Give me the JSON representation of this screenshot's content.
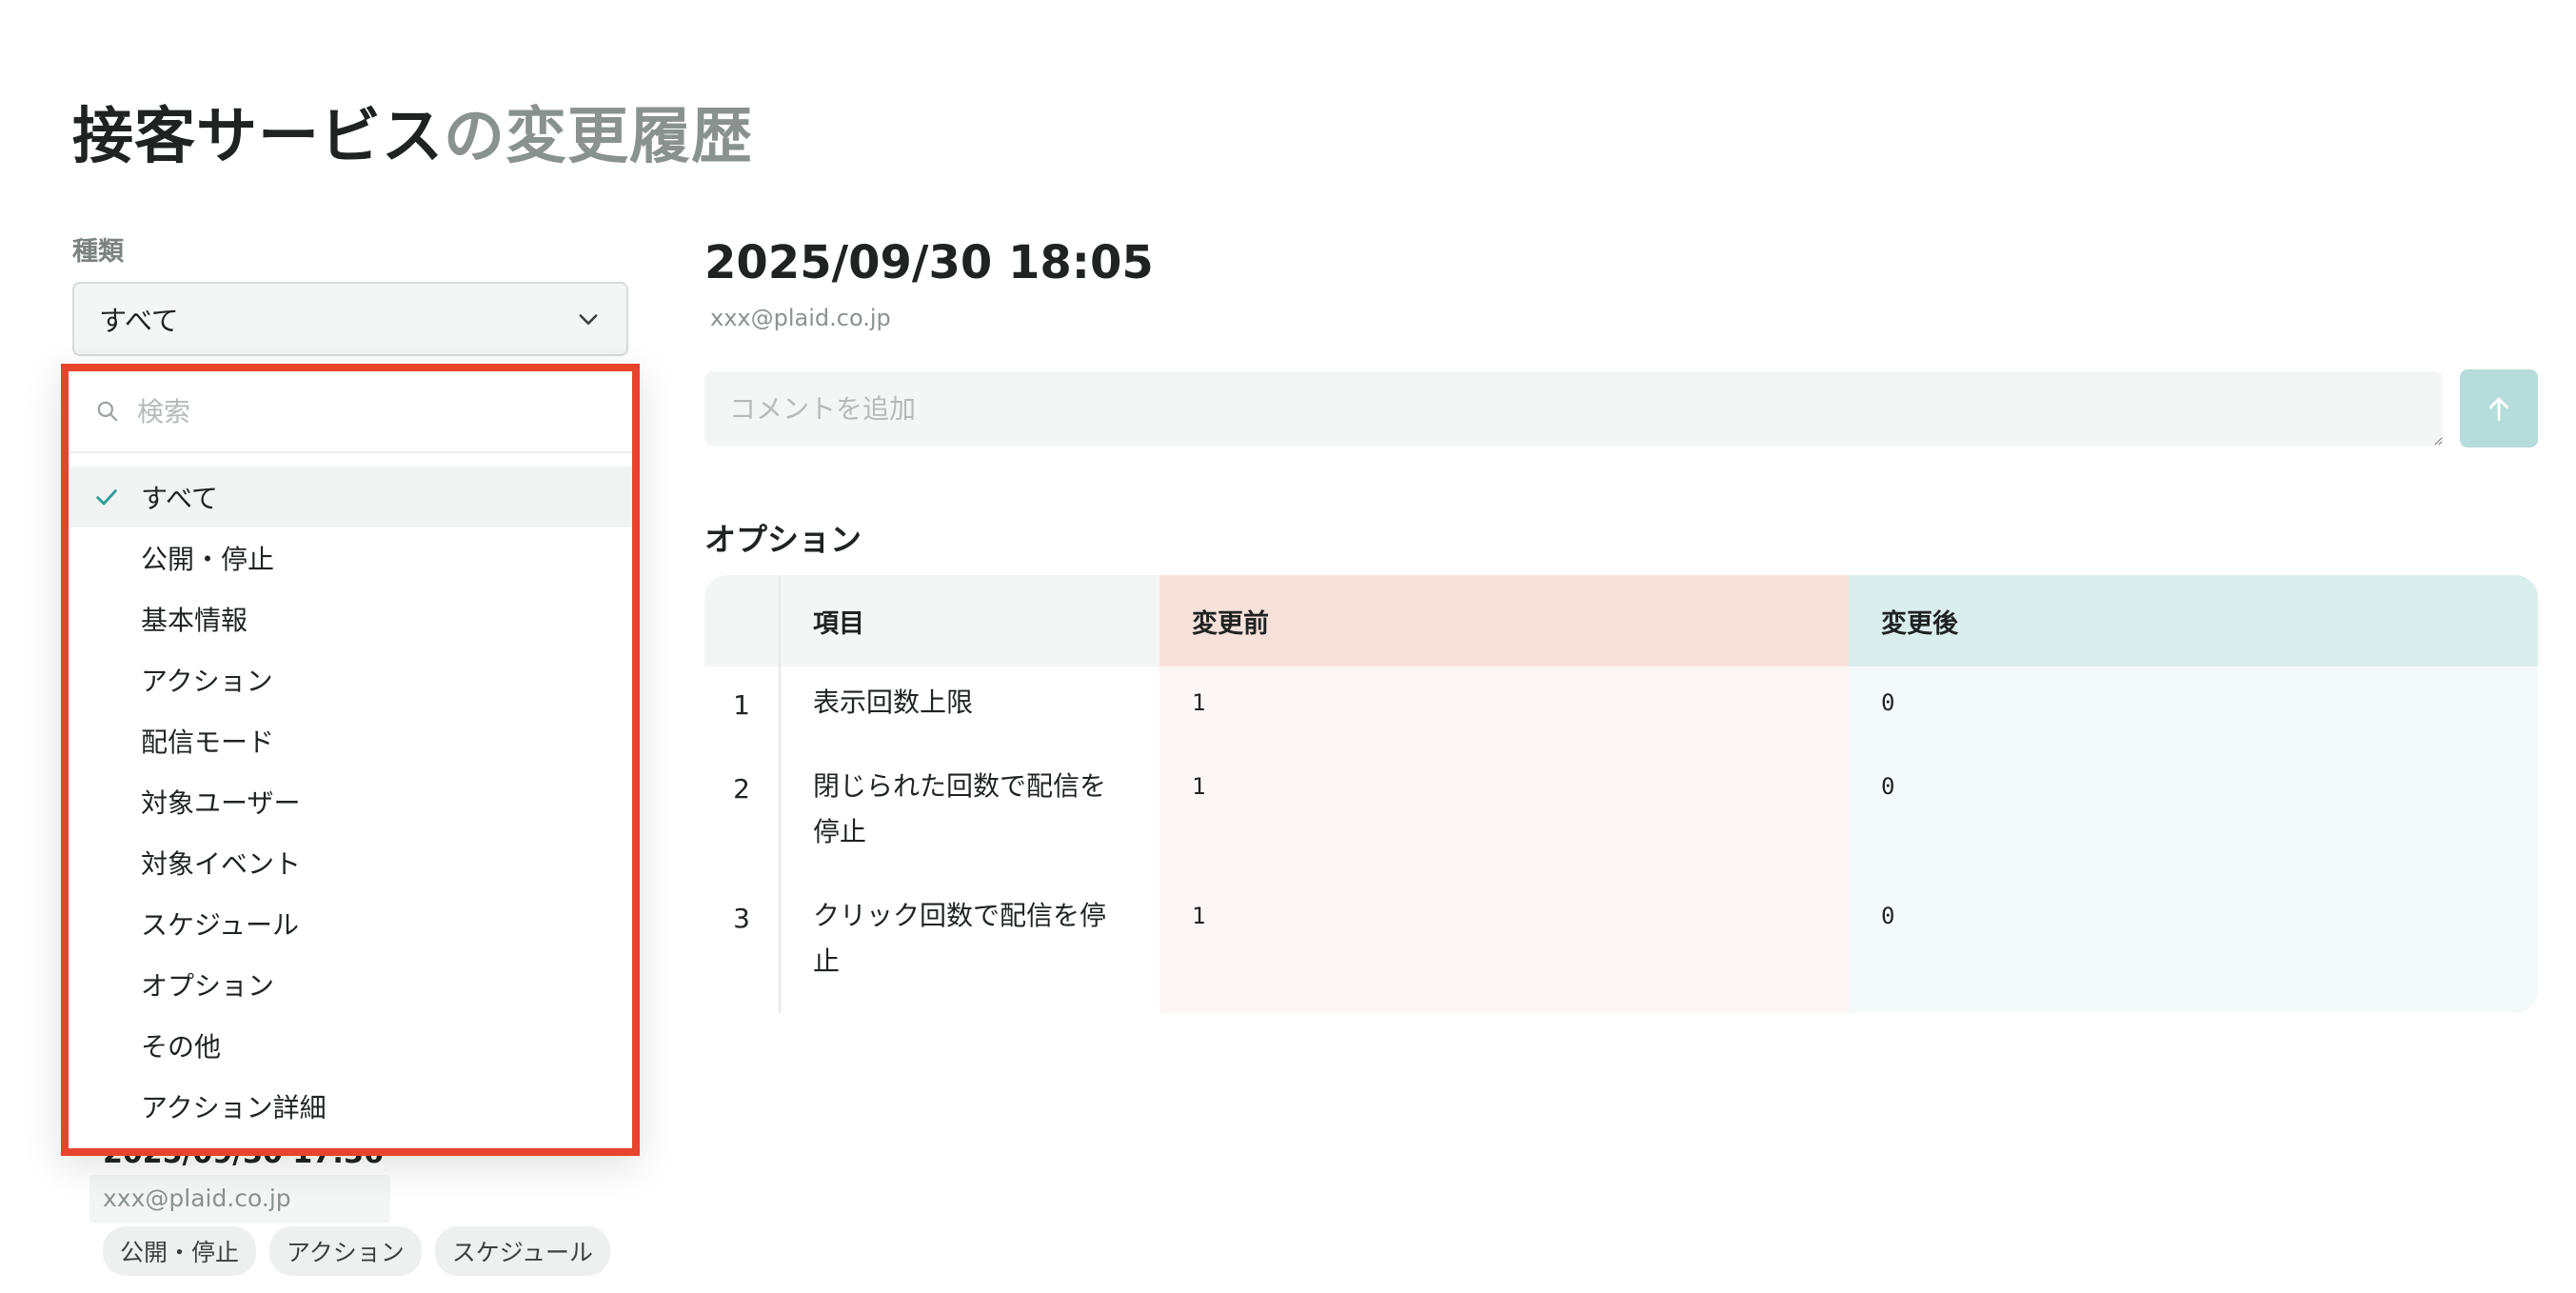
{
  "page": {
    "title_main": "接客サービス",
    "title_sub": "の変更履歴"
  },
  "filter": {
    "label": "種類",
    "selected": "すべて",
    "search_placeholder": "検索",
    "options": [
      "すべて",
      "公開・停止",
      "基本情報",
      "アクション",
      "配信モード",
      "対象ユーザー",
      "対象イベント",
      "スケジュール",
      "オプション",
      "その他",
      "アクション詳細"
    ],
    "selected_index": 0
  },
  "history": {
    "item": {
      "date": "2025/09/30 17:36",
      "user": "xxx@plaid.co.jp",
      "tags": [
        "公開・停止",
        "アクション",
        "スケジュール"
      ]
    }
  },
  "detail": {
    "date": "2025/09/30 18:05",
    "user": "xxx@plaid.co.jp",
    "comment_placeholder": "コメントを追加",
    "section_title": "オプション",
    "table": {
      "headers": {
        "item": "項目",
        "before": "変更前",
        "after": "変更後"
      },
      "rows": [
        {
          "num": "1",
          "item": "表示回数上限",
          "before": "1",
          "after": "0"
        },
        {
          "num": "2",
          "item": "閉じられた回数で配信を停止",
          "before": "1",
          "after": "0"
        },
        {
          "num": "3",
          "item": "クリック回数で配信を停止",
          "before": "1",
          "after": "0"
        }
      ]
    }
  },
  "colors": {
    "highlight_border": "#e8432d",
    "accent": "#2f9c95",
    "before_header": "#f7e2db",
    "after_header": "#dbeeee",
    "send_button": "#b6dcdb"
  },
  "icons": {
    "select_chevron": "chevron-down-icon",
    "search": "search-icon",
    "check": "check-icon",
    "send": "arrow-up-icon"
  }
}
